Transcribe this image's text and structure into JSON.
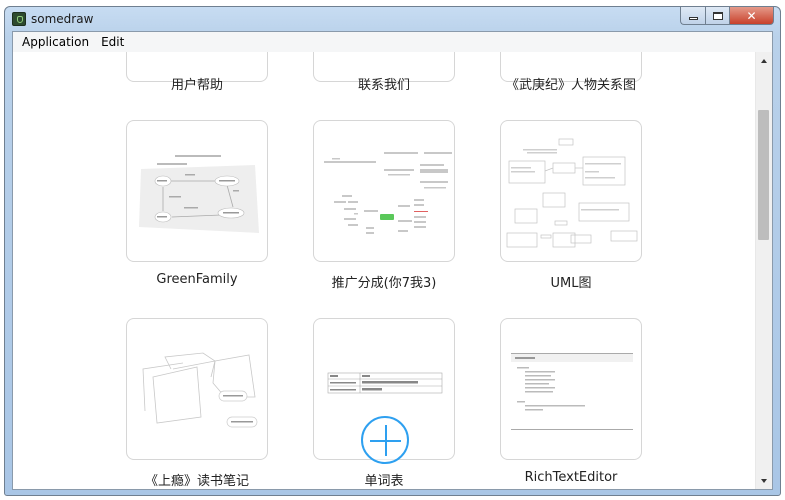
{
  "window": {
    "title": "somedraw",
    "controls": {
      "minimize_icon": "minimize-icon",
      "maximize_icon": "maximize-icon",
      "close_icon": "close-icon",
      "close_glyph": "✕"
    }
  },
  "menubar": {
    "items": [
      {
        "label": "Application"
      },
      {
        "label": "Edit"
      }
    ]
  },
  "gallery": {
    "rows": [
      {
        "items": [
          {
            "label": "用户帮助",
            "thumbnail": "blank"
          },
          {
            "label": "联系我们",
            "thumbnail": "blank"
          },
          {
            "label": "《武庚纪》人物关系图",
            "thumbnail": "blank"
          }
        ]
      },
      {
        "items": [
          {
            "label": "GreenFamily",
            "thumbnail": "family-diagram"
          },
          {
            "label": "推广分成(你7我3)",
            "thumbnail": "mindmap"
          },
          {
            "label": "UML图",
            "thumbnail": "uml-diagram"
          }
        ]
      },
      {
        "items": [
          {
            "label": "《上瘾》读书笔记",
            "thumbnail": "paper-notes"
          },
          {
            "label": "单词表",
            "thumbnail": "word-table"
          },
          {
            "label": "RichTextEditor",
            "thumbnail": "rich-text"
          }
        ]
      }
    ],
    "add_button_icon": "plus-icon"
  },
  "scrollbar": {
    "position_fraction": 0.2,
    "visible_fraction": 0.3
  },
  "colors": {
    "accent": "#2ea0f0",
    "mindmap_root": "#5ac85a"
  }
}
